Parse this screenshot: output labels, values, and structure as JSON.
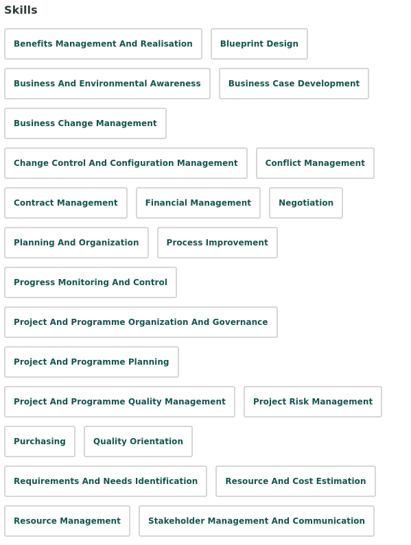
{
  "section": {
    "title": "Skills"
  },
  "skills": [
    "Benefits Management And Realisation",
    "Blueprint Design",
    "Business And Environmental Awareness",
    "Business Case Development",
    "Business Change Management",
    "Change Control And Configuration Management",
    "Conflict Management",
    "Contract Management",
    "Financial Management",
    "Negotiation",
    "Planning And Organization",
    "Process Improvement",
    "Progress Monitoring And Control",
    "Project And Programme Organization And Governance",
    "Project And Programme Planning",
    "Project And Programme Quality Management",
    "Project Risk Management",
    "Purchasing",
    "Quality Orientation",
    "Requirements And Needs Identification",
    "Resource And Cost Estimation",
    "Resource Management",
    "Stakeholder Management And Communication"
  ],
  "colors": {
    "title": "#2f3b3a",
    "chip_text": "#12574f",
    "chip_border": "#d6d6d6",
    "background": "#ffffff"
  }
}
